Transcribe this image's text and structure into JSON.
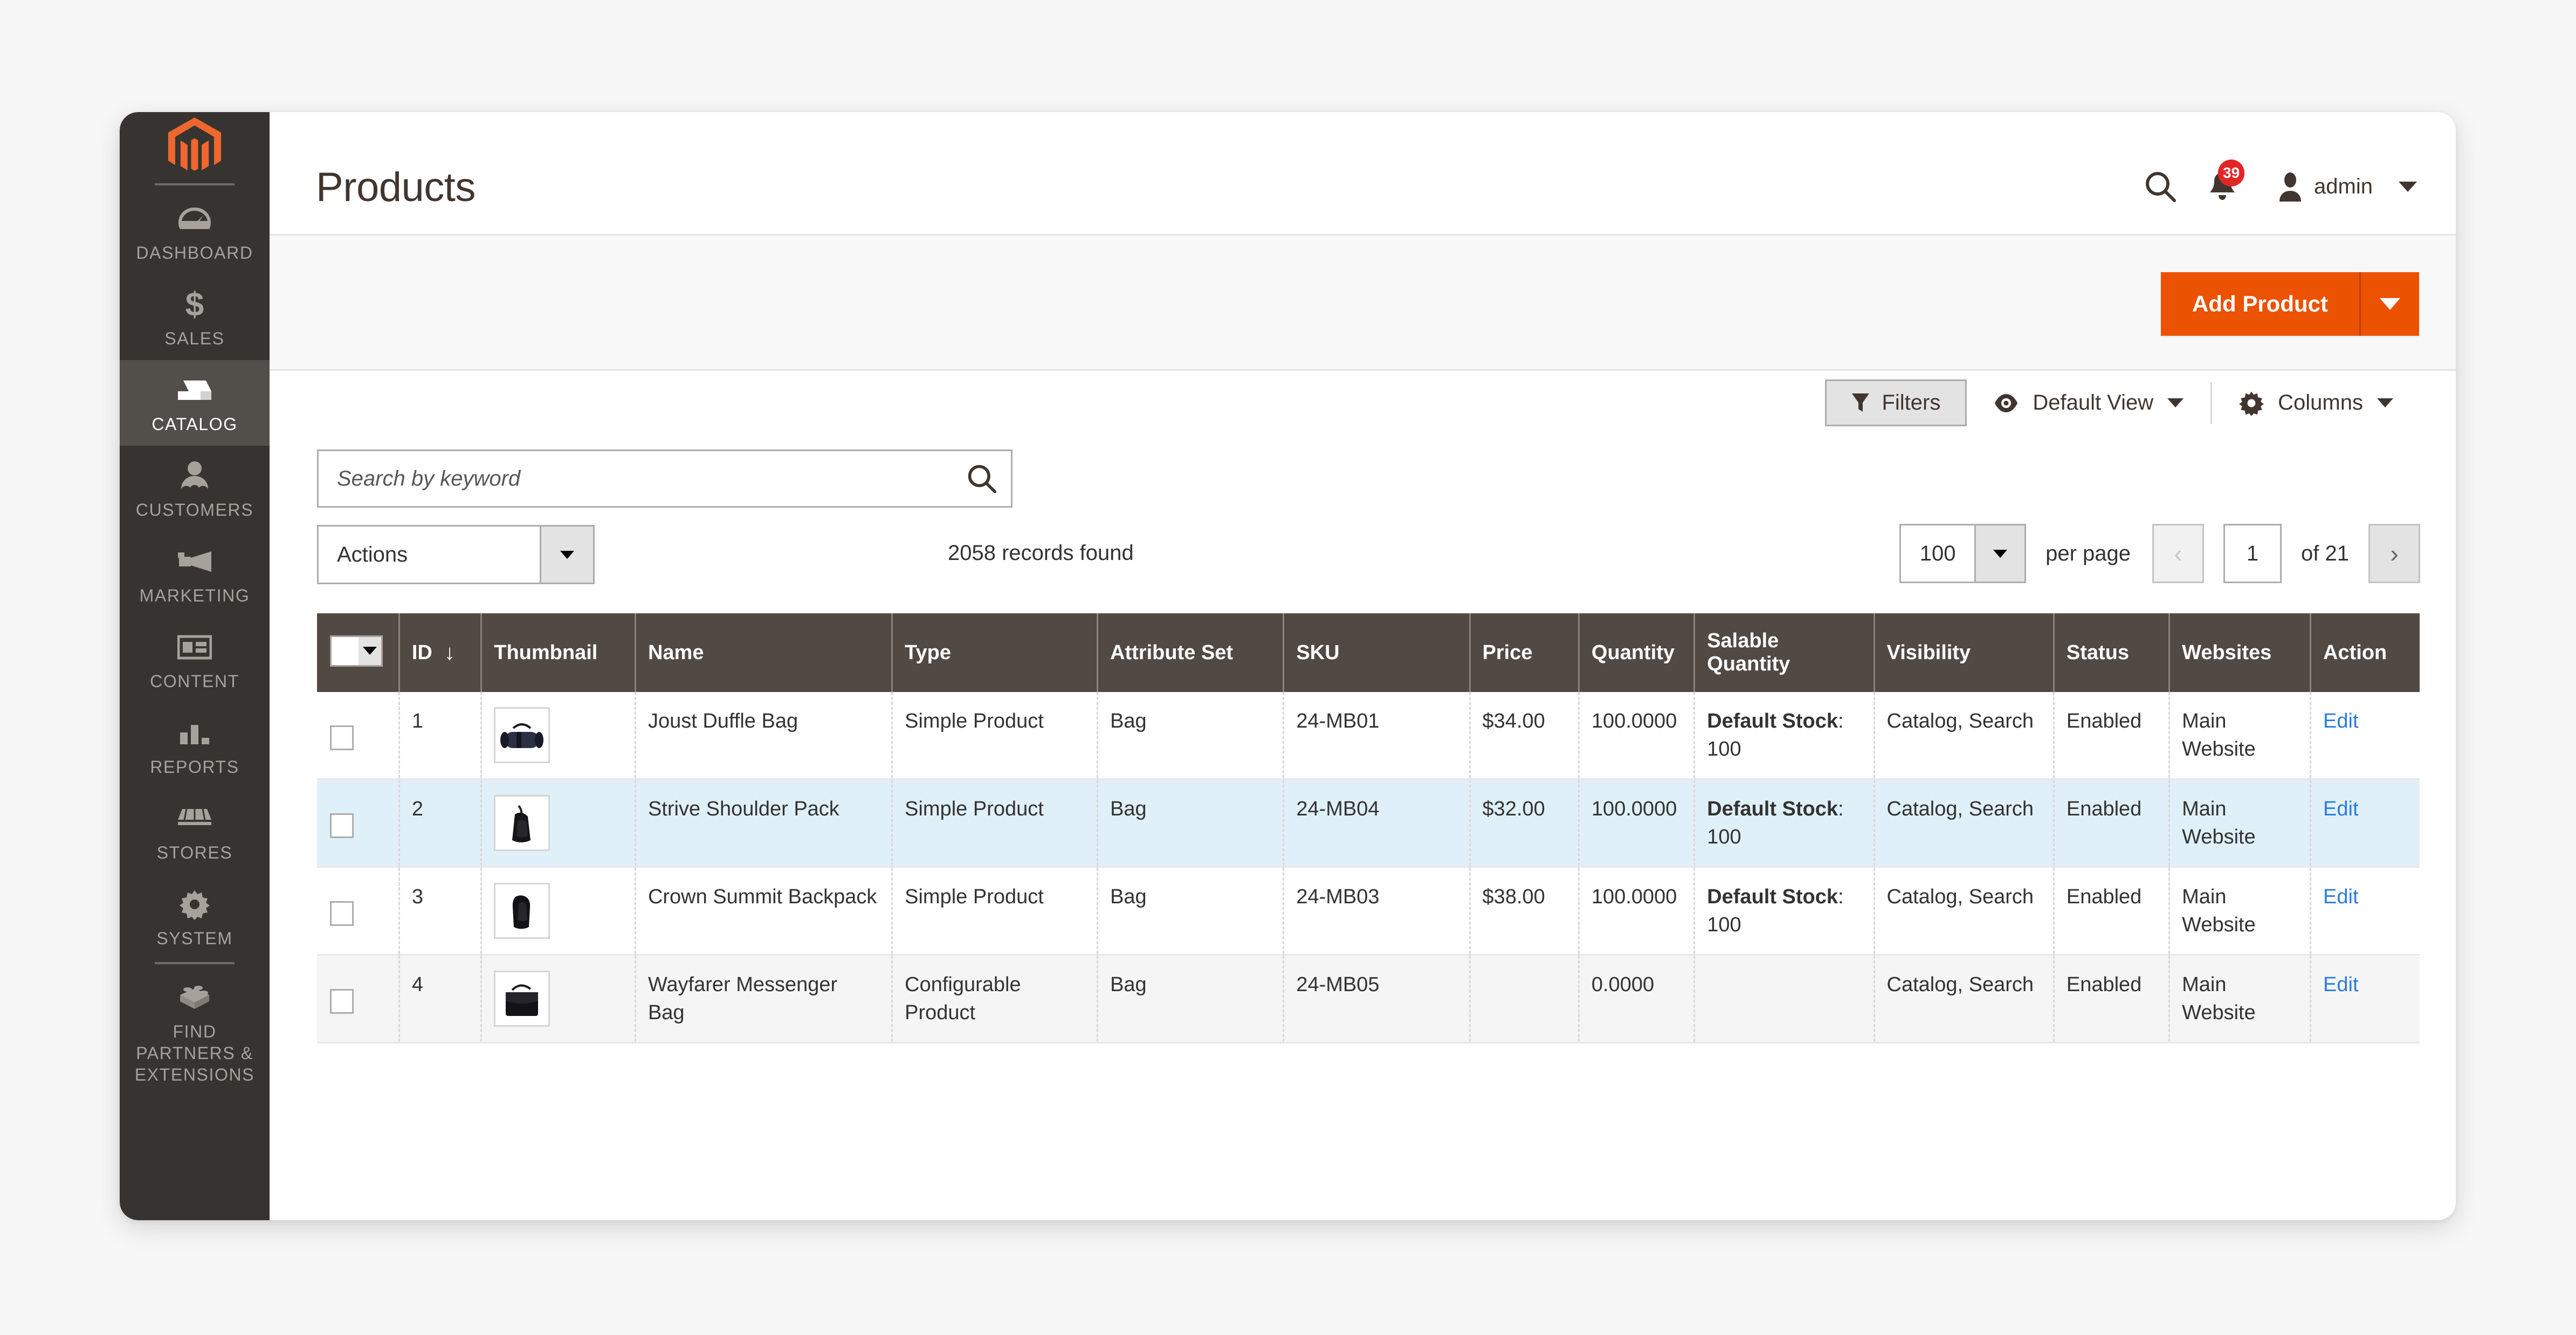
{
  "brand": {
    "accent": "#eb5202",
    "sidebar_bg": "#373330",
    "table_header_bg": "#514943",
    "link_color": "#2b7ddb",
    "badge_color": "#e22626"
  },
  "sidebar": {
    "logo": "magento-logo-icon",
    "items": [
      {
        "label": "Dashboard",
        "icon": "dashboard-icon",
        "active": false
      },
      {
        "label": "Sales",
        "icon": "dollar-icon",
        "active": false
      },
      {
        "label": "Catalog",
        "icon": "box-icon",
        "active": true
      },
      {
        "label": "Customers",
        "icon": "people-icon",
        "active": false
      },
      {
        "label": "Marketing",
        "icon": "megaphone-icon",
        "active": false
      },
      {
        "label": "Content",
        "icon": "layout-icon",
        "active": false
      },
      {
        "label": "Reports",
        "icon": "bar-chart-icon",
        "active": false
      },
      {
        "label": "Stores",
        "icon": "storefront-icon",
        "active": false
      },
      {
        "label": "System",
        "icon": "gear-icon",
        "active": false
      },
      {
        "label": "Find Partners & Extensions",
        "icon": "brick-icon",
        "active": false
      }
    ]
  },
  "header": {
    "title": "Products",
    "search_icon": "search-icon",
    "notifications": {
      "icon": "bell-icon",
      "count": "39"
    },
    "user": {
      "icon": "user-avatar-icon",
      "name": "admin",
      "caret": "chevron-down-icon"
    }
  },
  "actions_bar": {
    "add_product_label": "Add Product",
    "add_product_toggle": "chevron-down-icon"
  },
  "grid_toolbar": {
    "filters_label": "Filters",
    "filters_icon": "funnel-icon",
    "view_icon": "eye-icon",
    "view_label": "Default View",
    "columns_icon": "gear-icon",
    "columns_label": "Columns"
  },
  "search": {
    "placeholder": "Search by keyword",
    "value": "",
    "icon": "search-icon"
  },
  "controls": {
    "actions_label": "Actions",
    "records_found": "2058 records found",
    "per_page_value": "100",
    "per_page_text": "per page",
    "prev_label": "‹",
    "page_value": "1",
    "of_label": "of 21",
    "next_label": "›"
  },
  "table": {
    "columns": [
      {
        "key": "checkbox",
        "label": ""
      },
      {
        "key": "id",
        "label": "ID",
        "sort": "↓"
      },
      {
        "key": "thumbnail",
        "label": "Thumbnail"
      },
      {
        "key": "name",
        "label": "Name"
      },
      {
        "key": "type",
        "label": "Type"
      },
      {
        "key": "attribute_set",
        "label": "Attribute Set"
      },
      {
        "key": "sku",
        "label": "SKU"
      },
      {
        "key": "price",
        "label": "Price"
      },
      {
        "key": "quantity",
        "label": "Quantity"
      },
      {
        "key": "salable_quantity",
        "label": "Salable Quantity"
      },
      {
        "key": "visibility",
        "label": "Visibility"
      },
      {
        "key": "status",
        "label": "Status"
      },
      {
        "key": "websites",
        "label": "Websites"
      },
      {
        "key": "action",
        "label": "Action"
      }
    ],
    "rows": [
      {
        "id": "1",
        "thumbnail": "duffle-bag-thumbnail",
        "name": "Joust Duffle Bag",
        "type": "Simple Product",
        "attribute_set": "Bag",
        "sku": "24-MB01",
        "price": "$34.00",
        "quantity": "100.0000",
        "salable_stock_label": "Default Stock",
        "salable_stock_value": ": 100",
        "visibility": "Catalog, Search",
        "status": "Enabled",
        "websites": "Main Website",
        "action": "Edit",
        "highlight": "none"
      },
      {
        "id": "2",
        "thumbnail": "shoulder-pack-thumbnail",
        "name": "Strive Shoulder Pack",
        "type": "Simple Product",
        "attribute_set": "Bag",
        "sku": "24-MB04",
        "price": "$32.00",
        "quantity": "100.0000",
        "salable_stock_label": "Default Stock",
        "salable_stock_value": ": 100",
        "visibility": "Catalog, Search",
        "status": "Enabled",
        "websites": "Main Website",
        "action": "Edit",
        "highlight": "selected"
      },
      {
        "id": "3",
        "thumbnail": "backpack-thumbnail",
        "name": "Crown Summit Backpack",
        "type": "Simple Product",
        "attribute_set": "Bag",
        "sku": "24-MB03",
        "price": "$38.00",
        "quantity": "100.0000",
        "salable_stock_label": "Default Stock",
        "salable_stock_value": ": 100",
        "visibility": "Catalog, Search",
        "status": "Enabled",
        "websites": "Main Website",
        "action": "Edit",
        "highlight": "none"
      },
      {
        "id": "4",
        "thumbnail": "messenger-bag-thumbnail",
        "name": "Wayfarer Messenger Bag",
        "type": "Configurable Product",
        "attribute_set": "Bag",
        "sku": "24-MB05",
        "price": "",
        "quantity": "0.0000",
        "salable_stock_label": "",
        "salable_stock_value": "",
        "visibility": "Catalog, Search",
        "status": "Enabled",
        "websites": "Main Website",
        "action": "Edit",
        "highlight": "stripe"
      }
    ]
  }
}
